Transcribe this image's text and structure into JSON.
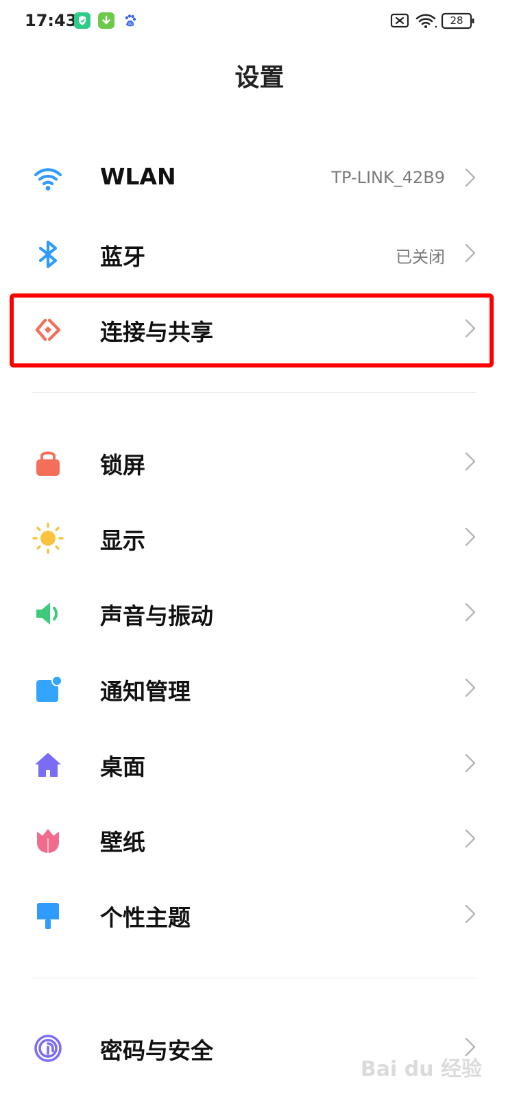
{
  "status_bar": {
    "time": "17:43",
    "battery": "28",
    "app_icons": [
      "shield-app-icon",
      "download-app-icon",
      "baidu-app-icon"
    ],
    "right_icons": [
      "sim-error-icon",
      "wifi-icon",
      "battery-icon"
    ]
  },
  "page": {
    "title": "设置"
  },
  "groups": [
    {
      "items": [
        {
          "icon": "wifi-icon",
          "label": "WLAN",
          "value": "TP-LINK_42B9",
          "color": "#2F9BFF"
        },
        {
          "icon": "bluetooth-icon",
          "label": "蓝牙",
          "value": "已关闭",
          "color": "#2F9BFF"
        },
        {
          "icon": "connection-share-icon",
          "label": "连接与共享",
          "value": "",
          "color": "#F46F59"
        }
      ]
    },
    {
      "items": [
        {
          "icon": "lock-icon",
          "label": "锁屏",
          "value": "",
          "color": "#F46F59"
        },
        {
          "icon": "sun-icon",
          "label": "显示",
          "value": "",
          "color": "#F9C33D"
        },
        {
          "icon": "speaker-icon",
          "label": "声音与振动",
          "value": "",
          "color": "#3DCB7B"
        },
        {
          "icon": "notification-icon",
          "label": "通知管理",
          "value": "",
          "color": "#34A5FF"
        },
        {
          "icon": "home-icon",
          "label": "桌面",
          "value": "",
          "color": "#7B6CF6"
        },
        {
          "icon": "tulip-icon",
          "label": "壁纸",
          "value": "",
          "color": "#F06B8C"
        },
        {
          "icon": "brush-icon",
          "label": "个性主题",
          "value": "",
          "color": "#2F9BFF"
        }
      ]
    },
    {
      "items": [
        {
          "icon": "fingerprint-icon",
          "label": "密码与安全",
          "value": "",
          "color": "#7B6CF6"
        }
      ]
    }
  ],
  "highlight": {
    "color": "#FF0000",
    "target": "连接与共享"
  }
}
